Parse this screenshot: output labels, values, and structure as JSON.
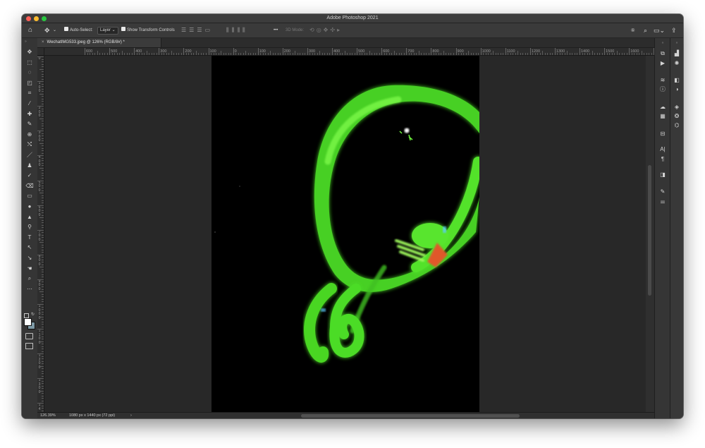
{
  "app": {
    "title": "Adobe Photoshop 2021"
  },
  "options_bar": {
    "auto_select_label": "Auto-Select:",
    "auto_select_value": "Layer",
    "show_transform_label": "Show Transform Controls",
    "more_label": "•••",
    "mode_3d_label": "3D Mode:"
  },
  "document_tab": {
    "close_glyph": "×",
    "title": "WechatIMG533.jpeg @ 126% (RGB/8#) *"
  },
  "ruler": {
    "top_labels": [
      "600",
      "500",
      "400",
      "300",
      "200",
      "100",
      "0",
      "100",
      "200",
      "300",
      "400",
      "500",
      "600",
      "700",
      "800",
      "900",
      "1000",
      "1100",
      "1200",
      "1300",
      "1400",
      "1500",
      "1600",
      "1700"
    ],
    "left_labels": [
      "0",
      "100",
      "200",
      "300",
      "400",
      "500",
      "600",
      "700",
      "800",
      "900",
      "1000",
      "1100",
      "1200",
      "1300",
      "14"
    ]
  },
  "status_bar": {
    "zoom": "126.39%",
    "doc_info": "1080 px x 1440 px (72 ppi)",
    "arrow": "›"
  },
  "tools": [
    {
      "name": "move-icon",
      "glyph": "✥"
    },
    {
      "name": "marquee-icon",
      "glyph": "⬚"
    },
    {
      "name": "lasso-icon",
      "glyph": "◌"
    },
    {
      "name": "object-select-icon",
      "glyph": "◰"
    },
    {
      "name": "crop-icon",
      "glyph": "⌗"
    },
    {
      "name": "eyedropper-icon",
      "glyph": "⁄"
    },
    {
      "name": "healing-brush-icon",
      "glyph": "✚"
    },
    {
      "name": "brush-icon",
      "glyph": "✎"
    },
    {
      "name": "stamp-icon",
      "glyph": "⊕"
    },
    {
      "name": "history-brush-icon",
      "glyph": "⤭"
    },
    {
      "name": "pen-tool-icon",
      "glyph": "／"
    },
    {
      "name": "clone-icon",
      "glyph": "♟"
    },
    {
      "name": "spot-heal-icon",
      "glyph": "✓"
    },
    {
      "name": "eraser-icon",
      "glyph": "⌫"
    },
    {
      "name": "gradient-icon",
      "glyph": "▭"
    },
    {
      "name": "blur-icon",
      "glyph": "●"
    },
    {
      "name": "sharpen-icon",
      "glyph": "▲"
    },
    {
      "name": "dodge-icon",
      "glyph": "⚲"
    },
    {
      "name": "type-icon",
      "glyph": "T"
    },
    {
      "name": "path-select-icon",
      "glyph": "↖"
    },
    {
      "name": "direct-select-icon",
      "glyph": "↘"
    },
    {
      "name": "hand-icon",
      "glyph": "☚"
    },
    {
      "name": "zoom-icon",
      "glyph": "⌕"
    },
    {
      "name": "more-tools-icon",
      "glyph": "⋯"
    }
  ]
}
